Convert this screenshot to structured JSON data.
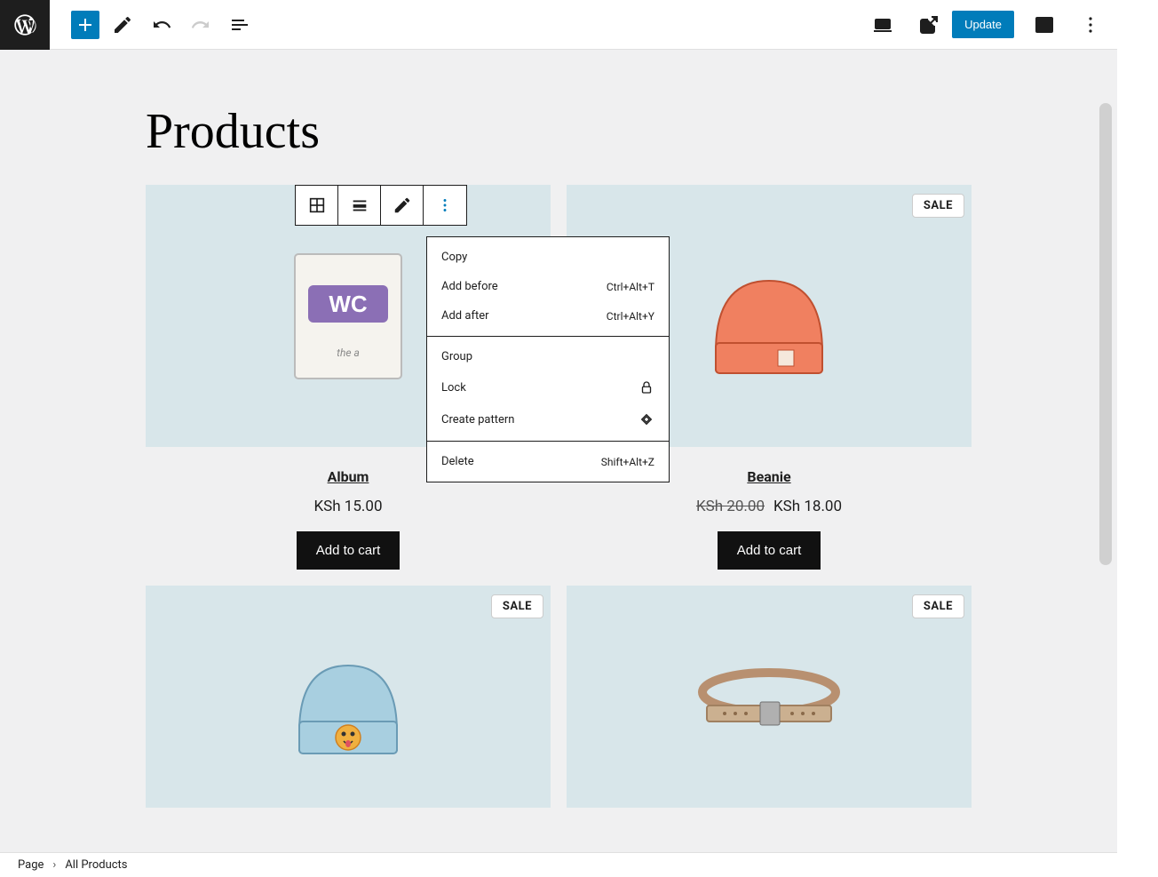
{
  "header": {
    "update_label": "Update"
  },
  "page": {
    "title": "Products"
  },
  "block_menu": {
    "copy": "Copy",
    "add_before": "Add before",
    "add_before_shortcut": "Ctrl+Alt+T",
    "add_after": "Add after",
    "add_after_shortcut": "Ctrl+Alt+Y",
    "group": "Group",
    "lock": "Lock",
    "create_pattern": "Create pattern",
    "delete": "Delete",
    "delete_shortcut": "Shift+Alt+Z"
  },
  "products": [
    {
      "name": "Album",
      "price": "KSh 15.00",
      "sale": false,
      "cta": "Add to cart"
    },
    {
      "name": "Beanie",
      "price": "KSh 18.00",
      "original": "KSh 20.00",
      "sale": true,
      "sale_label": "SALE",
      "cta": "Add to cart"
    },
    {
      "name_hidden": "Beanie with Logo",
      "sale": true,
      "sale_label": "SALE"
    },
    {
      "name_hidden": "Belt",
      "sale": true,
      "sale_label": "SALE"
    }
  ],
  "breadcrumb": {
    "root": "Page",
    "current": "All Products"
  }
}
